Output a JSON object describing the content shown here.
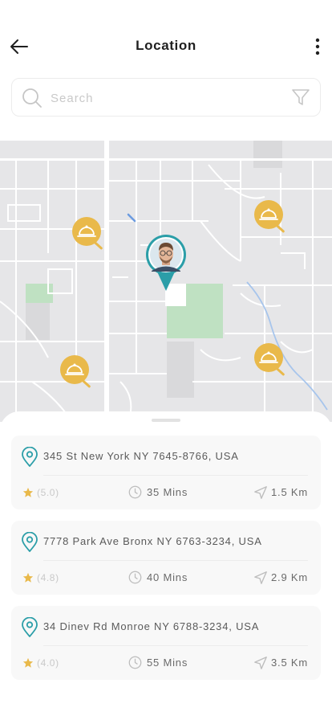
{
  "header": {
    "title": "Location",
    "back_icon": "arrow-left-icon",
    "menu_icon": "more-vertical-icon"
  },
  "search": {
    "placeholder": "Search",
    "value": "",
    "search_icon": "search-icon",
    "filter_icon": "filter-icon"
  },
  "map": {
    "restaurant_pins": 4,
    "user_marker_color": "#2b9ea8",
    "pin_color": "#e9b94a"
  },
  "locations": [
    {
      "address": "345 St New York NY 7645-8766, USA",
      "rating": "(5.0)",
      "time": "35 Mins",
      "distance": "1.5 Km"
    },
    {
      "address": "7778 Park Ave Bronx NY 6763-3234, USA",
      "rating": "(4.8)",
      "time": "40 Mins",
      "distance": "2.9 Km"
    },
    {
      "address": "34 Dinev Rd Monroe NY 6788-3234, USA",
      "rating": "(4.0)",
      "time": "55 Mins",
      "distance": "3.5 Km"
    }
  ],
  "colors": {
    "accent": "#2b9ea8",
    "star": "#e9b94a",
    "park": "#bfe1c2"
  }
}
